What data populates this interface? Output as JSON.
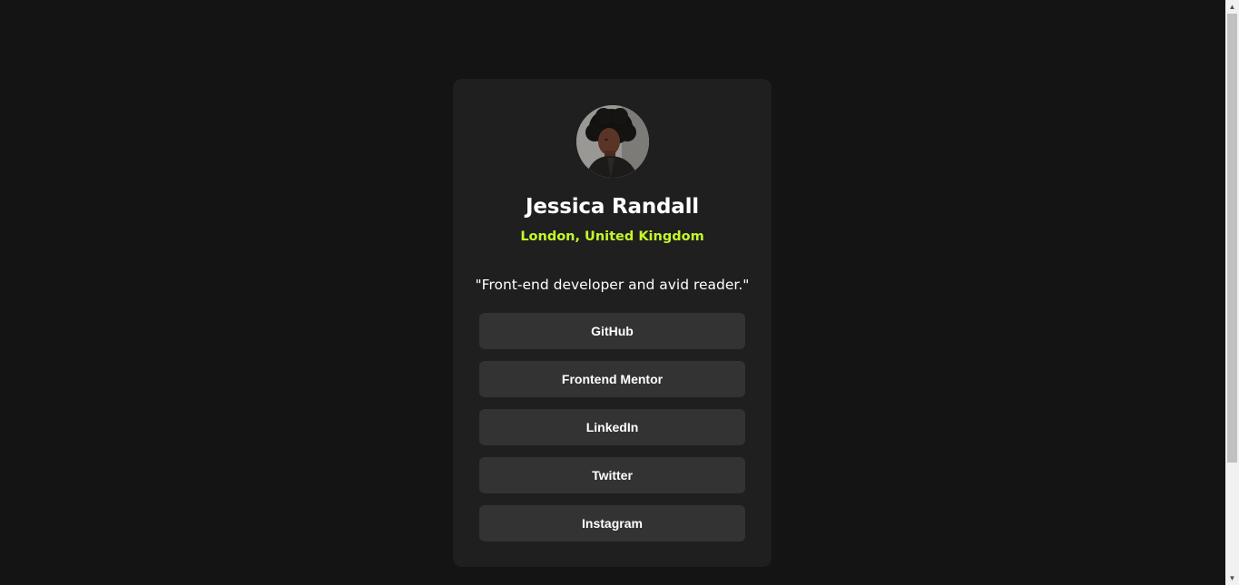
{
  "profile": {
    "name": "Jessica Randall",
    "location": "London, United Kingdom",
    "bio": "\"Front-end developer and avid reader.\"",
    "avatar_icon": "profile-photo"
  },
  "links": [
    {
      "label": "GitHub"
    },
    {
      "label": "Frontend Mentor"
    },
    {
      "label": "LinkedIn"
    },
    {
      "label": "Twitter"
    },
    {
      "label": "Instagram"
    }
  ],
  "colors": {
    "page_bg": "#141414",
    "card_bg": "#1f1f1f",
    "button_bg": "#333333",
    "accent": "#c4f82a",
    "text": "#ffffff"
  },
  "scrollbar": {
    "up_icon": "chevron-up-icon",
    "down_icon": "chevron-down-icon"
  }
}
